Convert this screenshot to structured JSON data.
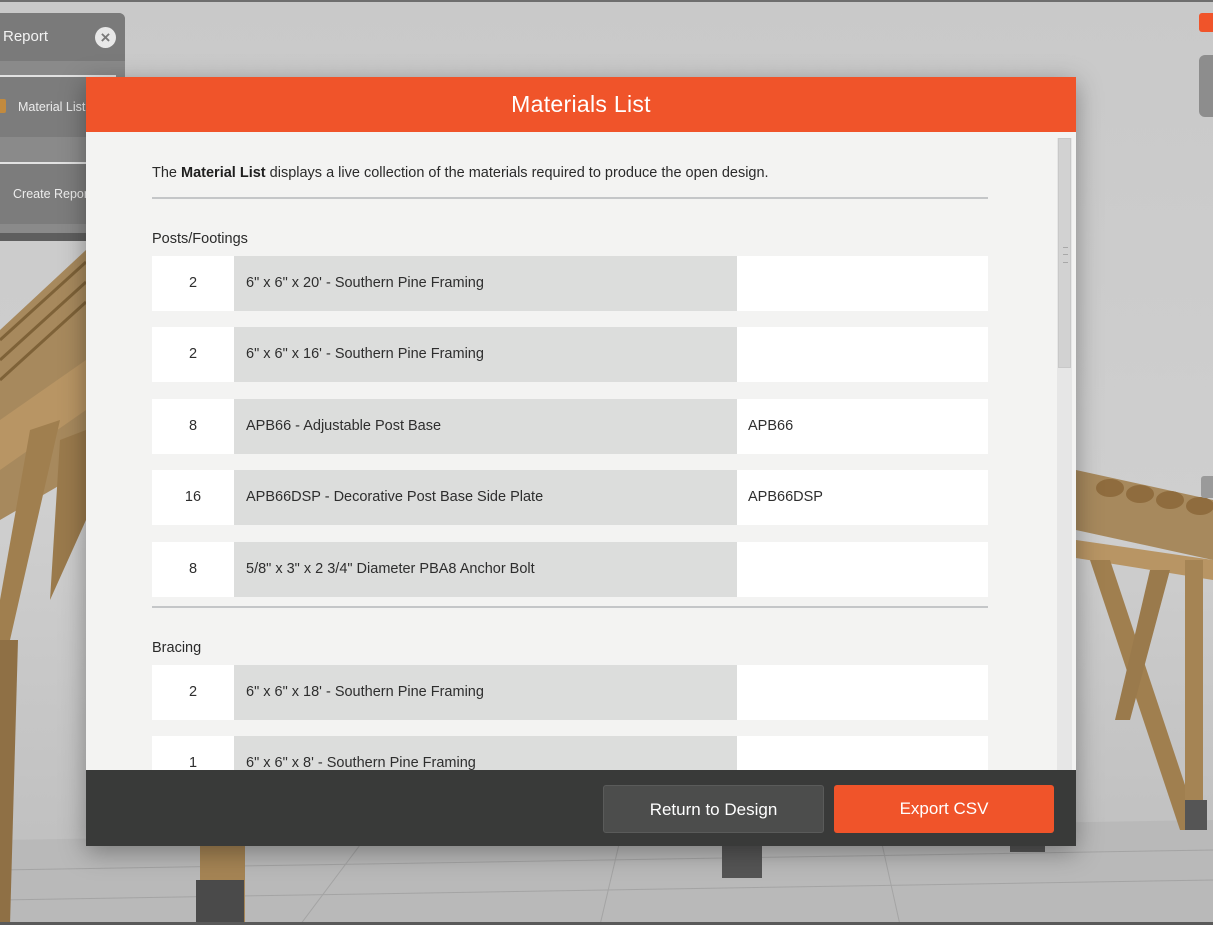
{
  "side_panel": {
    "title": "Report",
    "items": [
      {
        "label": "Material List"
      },
      {
        "label": "Create Report"
      }
    ]
  },
  "modal": {
    "title": "Materials List",
    "intro": {
      "before": "The ",
      "bold": "Material List",
      "after": " displays a live collection of the materials required to produce the open design."
    },
    "sections": [
      {
        "title": "Posts/Footings",
        "rows": [
          {
            "qty": "2",
            "description": "6\" x 6\" x 20' - Southern Pine Framing",
            "code": ""
          },
          {
            "qty": "2",
            "description": "6\" x 6\" x 16' - Southern Pine Framing",
            "code": ""
          },
          {
            "qty": "8",
            "description": "APB66 - Adjustable Post Base",
            "code": "APB66"
          },
          {
            "qty": "16",
            "description": "APB66DSP - Decorative Post Base Side Plate",
            "code": "APB66DSP"
          },
          {
            "qty": "8",
            "description": "5/8\" x 3\" x 2 3/4\" Diameter PBA8 Anchor Bolt",
            "code": ""
          }
        ]
      },
      {
        "title": "Bracing",
        "rows": [
          {
            "qty": "2",
            "description": "6\" x 6\" x 18' - Southern Pine Framing",
            "code": ""
          },
          {
            "qty": "1",
            "description": "6\" x 6\" x 8' - Southern Pine Framing",
            "code": ""
          }
        ]
      }
    ],
    "footer": {
      "return_label": "Return to Design",
      "export_label": "Export CSV"
    }
  },
  "colors": {
    "accent": "#f0542a",
    "footer_bg": "#393a39",
    "row_desc_bg": "#dcdddc"
  }
}
